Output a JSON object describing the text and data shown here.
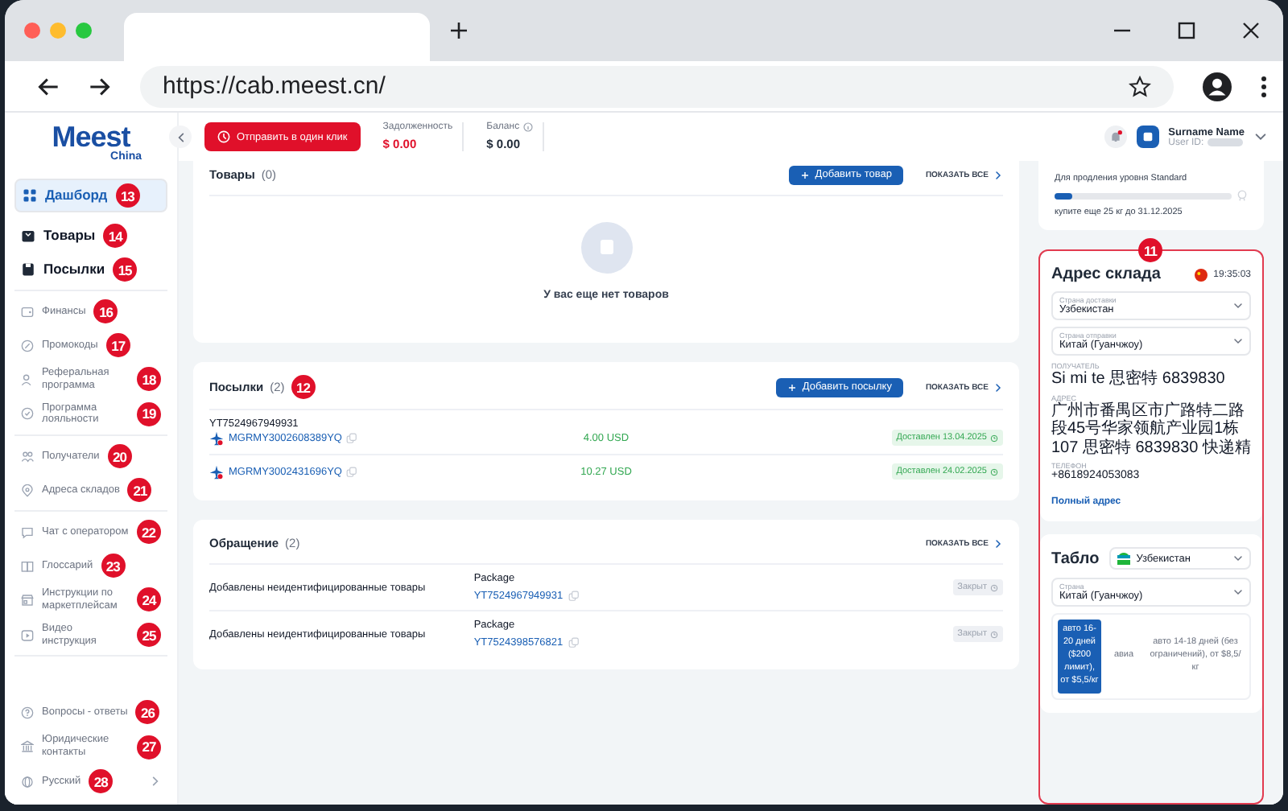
{
  "browser": {
    "url": "https://cab.meest.cn/"
  },
  "logo": {
    "name": "Meest",
    "sub": "China"
  },
  "sidebar": {
    "groups": [
      {
        "kind": "main",
        "items": [
          {
            "label": "Дашборд",
            "selected": true,
            "badge": "13"
          },
          {
            "label": "Товары",
            "selected": false,
            "badge": "14"
          },
          {
            "label": "Посылки",
            "selected": false,
            "badge": "15"
          }
        ]
      },
      {
        "kind": "minor",
        "items": [
          {
            "label": "Финансы",
            "selected": false,
            "badge": "16"
          },
          {
            "label": "Промокоды",
            "selected": false,
            "badge": "17"
          },
          {
            "label": "Реферальная программа",
            "selected": false,
            "badge": "18"
          },
          {
            "label": "Программа лояльности",
            "selected": false,
            "badge": "19"
          }
        ]
      },
      {
        "kind": "minor",
        "items": [
          {
            "label": "Получатели",
            "selected": false,
            "badge": "20"
          },
          {
            "label": "Адреса складов",
            "selected": false,
            "badge": "21"
          }
        ]
      },
      {
        "kind": "minor",
        "items": [
          {
            "label": "Чат с оператором",
            "selected": false,
            "badge": "22"
          },
          {
            "label": "Глоссарий",
            "selected": false,
            "badge": "23"
          },
          {
            "label": "Инструкции по маркетплейсам",
            "selected": false,
            "badge": "24"
          },
          {
            "label": "Видео инструкция",
            "selected": false,
            "badge": "25"
          }
        ]
      }
    ],
    "footer": [
      {
        "label": "Вопросы - ответы",
        "selected": false,
        "badge": "26"
      },
      {
        "label": "Юридические контакты",
        "selected": false,
        "badge": "27"
      },
      {
        "label": "Русский",
        "selected": false,
        "badge": "28"
      }
    ]
  },
  "header": {
    "send_button": "Отправить в один клик",
    "stats": [
      {
        "label": "Задолженность",
        "value": "$ 0.00",
        "kind": "debt"
      },
      {
        "label": "Баланс",
        "value": "$ 0.00",
        "kind": "balance"
      }
    ],
    "user": {
      "name": "Surname Name",
      "id_label": "User ID:"
    }
  },
  "goods": {
    "title": "Товары",
    "count": "(0)",
    "add": "Добавить товар",
    "show_all": "ПОКАЗАТЬ ВСЕ",
    "empty": "У вас еще нет товаров"
  },
  "parcels": {
    "title": "Посылки",
    "count": "(2)",
    "badge": "12",
    "add": "Добавить посылку",
    "show_all": "ПОКАЗАТЬ ВСЕ",
    "rows": [
      {
        "tracking": "YT7524967949931",
        "code": "MGRMY3002608389YQ",
        "amount": "4.00 USD",
        "status": "Доставлен 13.04.2025"
      },
      {
        "code": "MGRMY3002431696YQ",
        "amount": "10.27 USD",
        "status": "Доставлен 24.02.2025"
      }
    ]
  },
  "appeals": {
    "title": "Обращение",
    "count": "(2)",
    "show_all": "ПОКАЗАТЬ ВСЕ",
    "rows": [
      {
        "subject": "Добавлены неидентифицированные товары",
        "type": "Package",
        "code": "YT7524967949931",
        "status": "Закрыт"
      },
      {
        "subject": "Добавлены неидентифицированные товары",
        "type": "Package",
        "code": "YT7524398576821",
        "status": "Закрыт"
      }
    ]
  },
  "loyalty": {
    "text": "Для продления уровня Standard",
    "level": 0.1,
    "note": "купите еще 25 кг до 31.12.2025"
  },
  "warehouse": {
    "badge": "11",
    "title": "Адрес склада",
    "time": "19:35:03",
    "selects": [
      {
        "label": "Страна доставки",
        "value": "Узбекистан"
      },
      {
        "label": "Страна отправки",
        "value": "Китай (Гуанчжоу)"
      }
    ],
    "fields": [
      {
        "label": "ПОЛУЧАТЕЛЬ",
        "value": "Si mi te 思密特 6839830"
      },
      {
        "label": "АДРЕС",
        "value": "广州市番禺区市广路特二路段45号华家领航产业园1栋 107 思密特 6839830 快递精"
      },
      {
        "label": "ТЕЛЕФОН",
        "value": "+8618924053083"
      }
    ],
    "link": "Полный адрес"
  },
  "tablo": {
    "title": "Табло",
    "country": "Узбекистан",
    "select": {
      "label": "Страна",
      "value": "Китай (Гуанчжоу)"
    },
    "options": [
      {
        "text": "авто 16-20 дней ($200 лимит), от $5,5/кг",
        "selected": true
      },
      {
        "text": "авиа",
        "selected": false
      },
      {
        "text": "авто 14-18 дней (без ограничений), от $8,5/кг",
        "selected": false
      }
    ]
  }
}
